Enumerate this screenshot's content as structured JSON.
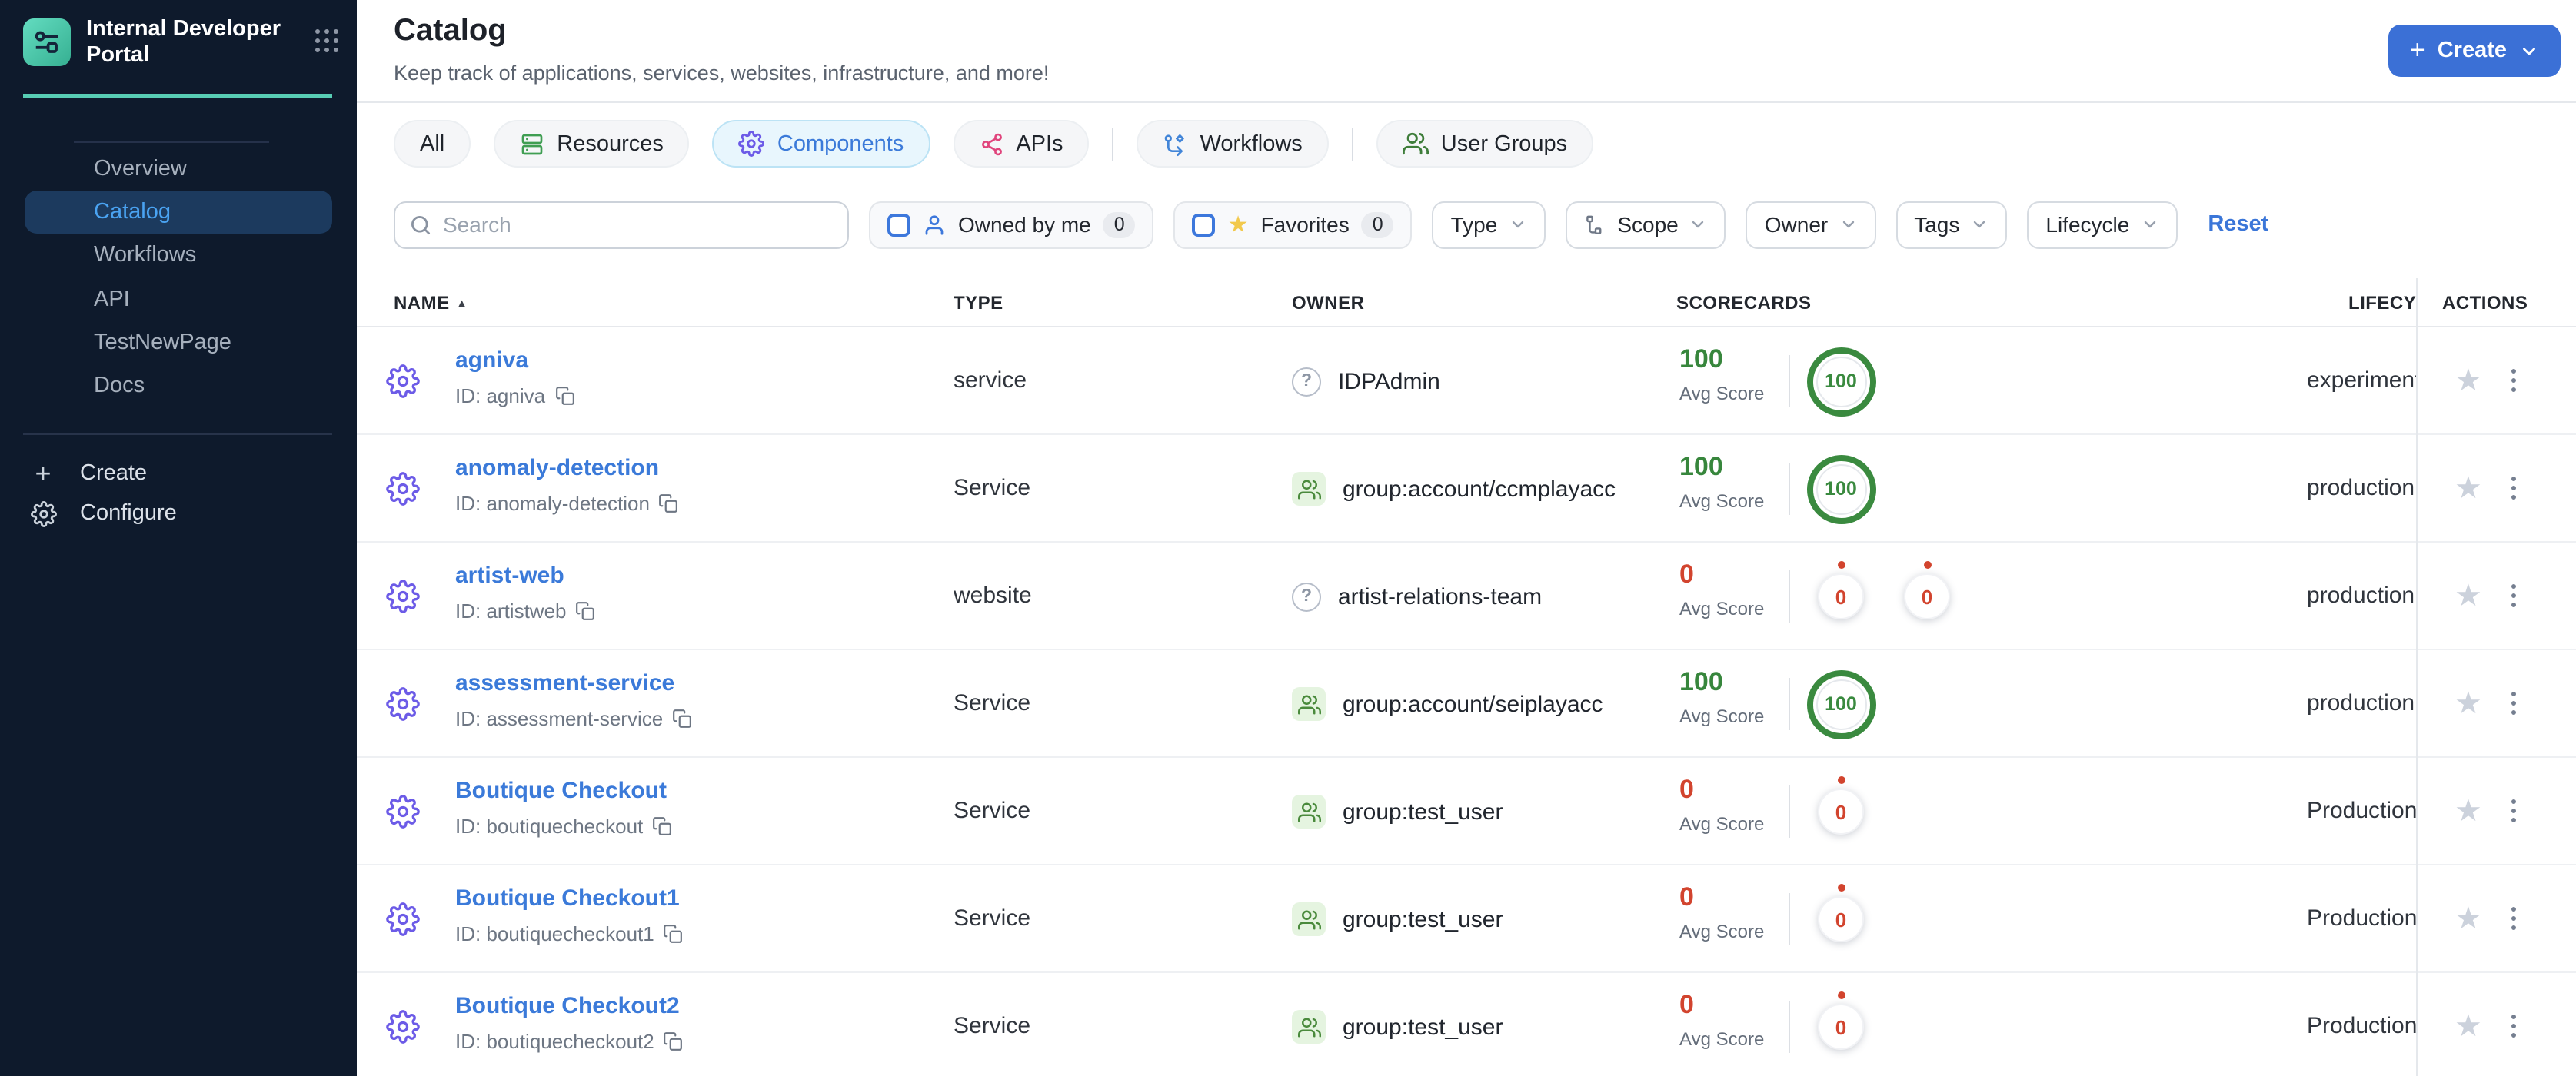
{
  "colors": {
    "brand_teal": "#57cdb4",
    "primary_blue": "#3b70d6",
    "link_blue": "#3b7ad9",
    "success_green": "#3a8a3f",
    "danger_red": "#d2442e",
    "sidebar_bg": "#0e1a2c"
  },
  "icons": {
    "plus": "+",
    "star": "★",
    "sort_asc": "▲"
  },
  "sidebar": {
    "title": "Internal Developer Portal",
    "nav": [
      {
        "label": "Overview",
        "active": false
      },
      {
        "label": "Catalog",
        "active": true
      },
      {
        "label": "Workflows",
        "active": false
      },
      {
        "label": "API",
        "active": false
      },
      {
        "label": "TestNewPage",
        "active": false
      },
      {
        "label": "Docs",
        "active": false
      }
    ],
    "create_label": "Create",
    "configure_label": "Configure"
  },
  "header": {
    "title": "Catalog",
    "subtitle": "Keep track of applications, services, websites, infrastructure, and more!",
    "create_button_label": "Create"
  },
  "tabs": [
    {
      "label": "All",
      "icon": null,
      "active": false,
      "divider_after": false
    },
    {
      "label": "Resources",
      "icon": "resources-icon",
      "icon_color": "#3f9e52",
      "active": false,
      "divider_after": false
    },
    {
      "label": "Components",
      "icon": "components-gear-icon",
      "icon_color": "#6c5be7",
      "active": true,
      "divider_after": false
    },
    {
      "label": "APIs",
      "icon": "apis-icon",
      "icon_color": "#e0447c",
      "active": false,
      "divider_after": true
    },
    {
      "label": "Workflows",
      "icon": "workflows-icon",
      "icon_color": "#4285d8",
      "active": false,
      "divider_after": true
    },
    {
      "label": "User Groups",
      "icon": "user-groups-icon",
      "icon_color": "#3e7d3a",
      "active": false,
      "divider_after": false
    }
  ],
  "filters": {
    "search_placeholder": "Search",
    "owned_by_me": {
      "label": "Owned by me",
      "count": "0"
    },
    "favorites": {
      "label": "Favorites",
      "count": "0"
    },
    "dropdowns": [
      {
        "label": "Type",
        "icon": null
      },
      {
        "label": "Scope",
        "icon": "scope-tree-icon"
      },
      {
        "label": "Owner",
        "icon": null
      },
      {
        "label": "Tags",
        "icon": null
      },
      {
        "label": "Lifecycle",
        "icon": null
      }
    ],
    "reset_label": "Reset"
  },
  "table": {
    "columns": [
      "NAME",
      "TYPE",
      "OWNER",
      "SCORECARDS",
      "LIFECYCLE",
      "ACTIONS"
    ],
    "avg_score_label": "Avg Score",
    "rows": [
      {
        "name": "agniva",
        "id_label": "ID: agniva",
        "type": "service",
        "owner": {
          "icon": "question",
          "label": "IDPAdmin"
        },
        "score": {
          "avg": "100",
          "status": "good",
          "gauges": [
            {
              "value": "100",
              "status": "good"
            }
          ]
        },
        "lifecycle": "experimental"
      },
      {
        "name": "anomaly-detection",
        "id_label": "ID: anomaly-detection",
        "type": "Service",
        "owner": {
          "icon": "group",
          "label": "group:account/ccmplayacc"
        },
        "score": {
          "avg": "100",
          "status": "good",
          "gauges": [
            {
              "value": "100",
              "status": "good"
            }
          ]
        },
        "lifecycle": "production"
      },
      {
        "name": "artist-web",
        "id_label": "ID: artistweb",
        "type": "website",
        "owner": {
          "icon": "question",
          "label": "artist-relations-team"
        },
        "score": {
          "avg": "0",
          "status": "bad",
          "gauges": [
            {
              "value": "0",
              "status": "bad"
            },
            {
              "value": "0",
              "status": "bad"
            }
          ]
        },
        "lifecycle": "production"
      },
      {
        "name": "assessment-service",
        "id_label": "ID: assessment-service",
        "type": "Service",
        "owner": {
          "icon": "group",
          "label": "group:account/seiplayacc"
        },
        "score": {
          "avg": "100",
          "status": "good",
          "gauges": [
            {
              "value": "100",
              "status": "good"
            }
          ]
        },
        "lifecycle": "production"
      },
      {
        "name": "Boutique Checkout",
        "id_label": "ID: boutiquecheckout",
        "type": "Service",
        "owner": {
          "icon": "group",
          "label": "group:test_user"
        },
        "score": {
          "avg": "0",
          "status": "bad",
          "gauges": [
            {
              "value": "0",
              "status": "bad"
            }
          ]
        },
        "lifecycle": "Production"
      },
      {
        "name": "Boutique Checkout1",
        "id_label": "ID: boutiquecheckout1",
        "type": "Service",
        "owner": {
          "icon": "group",
          "label": "group:test_user"
        },
        "score": {
          "avg": "0",
          "status": "bad",
          "gauges": [
            {
              "value": "0",
              "status": "bad"
            }
          ]
        },
        "lifecycle": "Production"
      },
      {
        "name": "Boutique Checkout2",
        "id_label": "ID: boutiquecheckout2",
        "type": "Service",
        "owner": {
          "icon": "group",
          "label": "group:test_user"
        },
        "score": {
          "avg": "0",
          "status": "bad",
          "gauges": [
            {
              "value": "0",
              "status": "bad"
            }
          ]
        },
        "lifecycle": "Production"
      }
    ]
  }
}
